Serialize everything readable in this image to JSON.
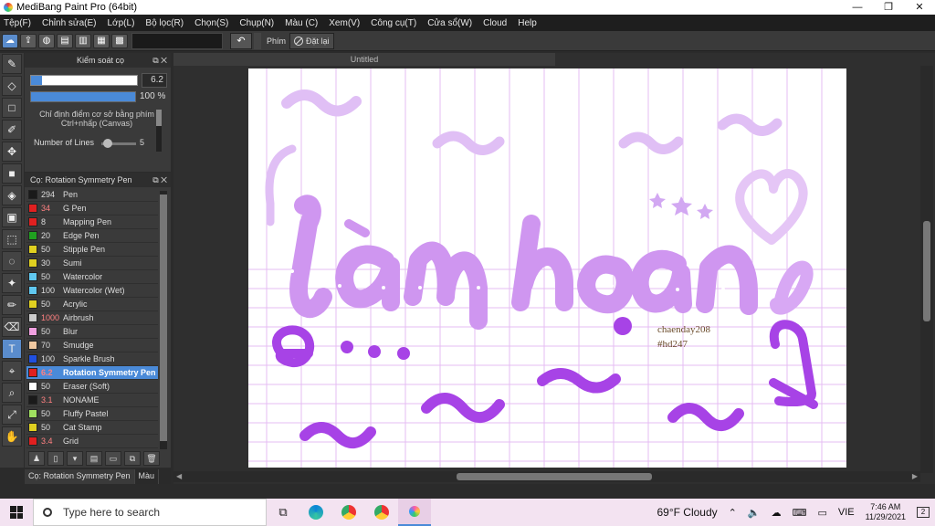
{
  "window": {
    "title": "MediBang Paint Pro (64bit)",
    "minimize": "—",
    "maximize": "❐",
    "close": "✕"
  },
  "menu": [
    "Tệp(F)",
    "Chỉnh sửa(E)",
    "Lớp(L)",
    "Bộ lọc(R)",
    "Chọn(S)",
    "Chụp(N)",
    "Màu (C)",
    "Xem(V)",
    "Công cụ(T)",
    "Cửa sổ(W)",
    "Cloud",
    "Help"
  ],
  "toolbar": {
    "shortcut_label": "Phím",
    "reset_label": "Đặt lại",
    "undo_icon": "↶"
  },
  "brush_control": {
    "title": "Kiểm soát cọ",
    "size": "6.2",
    "opacity": "100 %",
    "hint": "Chỉ định điểm cơ sở bằng phím Ctrl+nhấp (Canvas)",
    "lines_label": "Number of Lines",
    "lines_value": "5"
  },
  "brush_panel": {
    "title": "Cọ: Rotation Symmetry Pen",
    "items": [
      {
        "size": "294",
        "name": "Pen",
        "color": "#1a1a1a",
        "red": false
      },
      {
        "size": "34",
        "name": "G Pen",
        "color": "#e02020",
        "red": true
      },
      {
        "size": "8",
        "name": "Mapping Pen",
        "color": "#e02020",
        "red": false
      },
      {
        "size": "20",
        "name": "Edge Pen",
        "color": "#20a020",
        "red": false
      },
      {
        "size": "50",
        "name": "Stipple Pen",
        "color": "#e0d020",
        "red": false
      },
      {
        "size": "30",
        "name": "Sumi",
        "color": "#e0d020",
        "red": false
      },
      {
        "size": "50",
        "name": "Watercolor",
        "color": "#60c8f0",
        "red": false
      },
      {
        "size": "100",
        "name": "Watercolor (Wet)",
        "color": "#60c8f0",
        "red": false
      },
      {
        "size": "50",
        "name": "Acrylic",
        "color": "#e0d020",
        "red": false
      },
      {
        "size": "1000",
        "name": "Airbrush",
        "color": "#cccccc",
        "red": true
      },
      {
        "size": "50",
        "name": "Blur",
        "color": "#f0a0e0",
        "red": false
      },
      {
        "size": "70",
        "name": "Smudge",
        "color": "#f0c8a0",
        "red": false
      },
      {
        "size": "100",
        "name": "Sparkle Brush",
        "color": "#2050e0",
        "red": false
      },
      {
        "size": "6.2",
        "name": "Rotation Symmetry Pen",
        "color": "#e02020",
        "red": true,
        "selected": true
      },
      {
        "size": "50",
        "name": "Eraser (Soft)",
        "color": "#ffffff",
        "red": false
      },
      {
        "size": "3.1",
        "name": "NONAME",
        "color": "#1a1a1a",
        "red": true
      },
      {
        "size": "50",
        "name": "Fluffy Pastel",
        "color": "#a0e060",
        "red": false
      },
      {
        "size": "50",
        "name": "Cat Stamp",
        "color": "#e0d020",
        "red": false
      },
      {
        "size": "3.4",
        "name": "Grid",
        "color": "#e02020",
        "red": true
      }
    ]
  },
  "left_tabs": [
    "Cọ: Rotation Symmetry Pen",
    "Màu"
  ],
  "document": {
    "tab": "Untitled",
    "credit_line1": "chaenday208",
    "credit_line2": "#hd247"
  },
  "taskbar": {
    "search_placeholder": "Type here to search",
    "weather": "69°F  Cloudy",
    "lang": "VIE",
    "time": "7:46 AM",
    "date": "11/29/2021",
    "notif_count": "2"
  },
  "colors": {
    "accent": "#4a8ad8",
    "stroke_light": "#c79ef2",
    "stroke_dark": "#a03ae0",
    "grid": "#e4b8f2"
  }
}
